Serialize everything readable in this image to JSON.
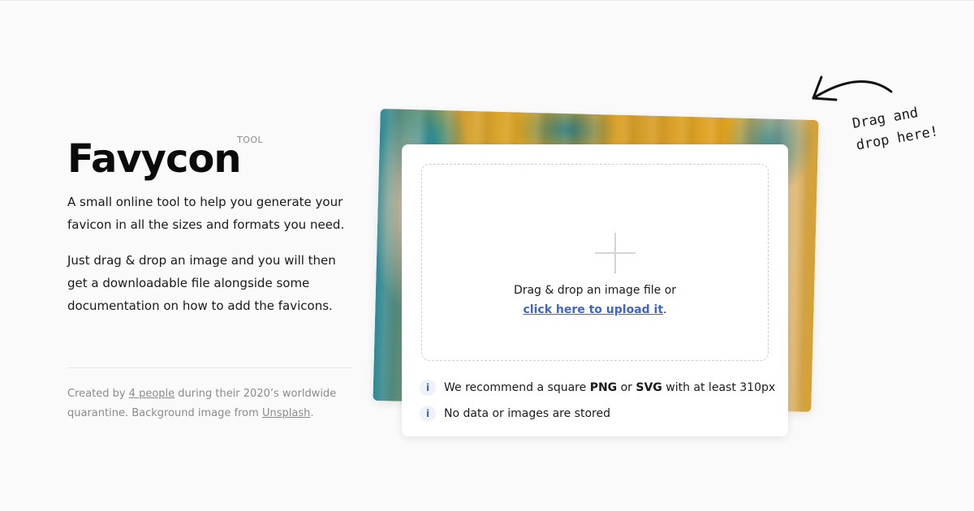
{
  "brand": {
    "title": "Favycon",
    "tag": "TOOL"
  },
  "intro": {
    "paragraph1": "A small online tool to help you generate your favicon in all the sizes and formats you need.",
    "paragraph2": "Just drag & drop an image and you will then get a downloadable file alongside some documentation on how to add the favicons."
  },
  "credits": {
    "prefix": "Created by",
    "people_link": "4 people",
    "middle": "during their 2020’s worldwide quarantine. Background image from",
    "unsplash_link": "Unsplash",
    "suffix": "."
  },
  "dropzone": {
    "text": "Drag & drop an image file or",
    "link": "click here to upload it",
    "link_suffix": "."
  },
  "info": {
    "icon_glyph": "i",
    "row1": {
      "pre": "We recommend a square",
      "png": "PNG",
      "or": "or",
      "svg": "SVG",
      "post": "with at least 310px"
    },
    "row2": "No data or images are stored"
  },
  "callout": {
    "line1": "Drag and",
    "line2": "drop here!"
  },
  "colors": {
    "accent": "#3d63d6",
    "background": "#fafafa"
  },
  "icons": [
    "plus-icon",
    "info-icon",
    "arrow-icon"
  ]
}
